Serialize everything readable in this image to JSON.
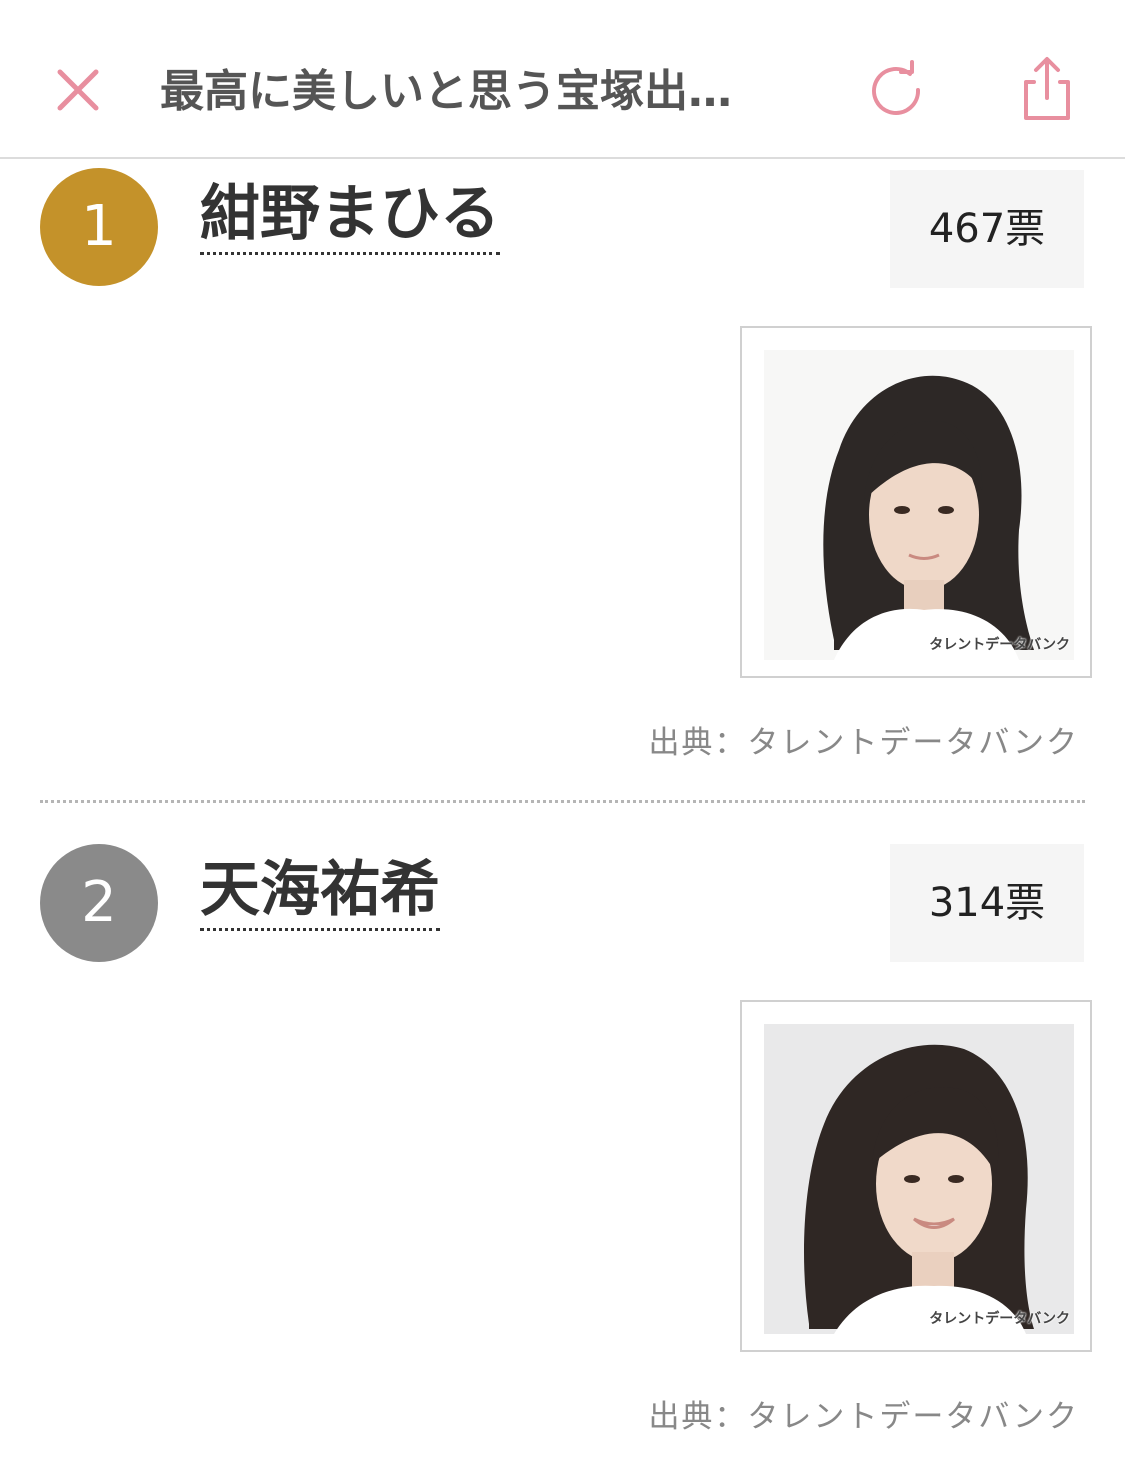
{
  "header": {
    "title": "最高に美しいと思う宝塚出…",
    "close_icon": "close-icon",
    "reload_icon": "reload-icon",
    "share_icon": "share-icon",
    "accent_color": "#e88f9f"
  },
  "entries": [
    {
      "rank": "1",
      "name": "紺野まひる",
      "votes": "467票",
      "badge_color": "#c4922a",
      "photo_watermark": "タレントデータバンク",
      "credit": "出典：タレントデータバンク"
    },
    {
      "rank": "2",
      "name": "天海祐希",
      "votes": "314票",
      "badge_color": "#8a8a8a",
      "photo_watermark": "タレントデータバンク",
      "credit": "出典：タレントデータバンク"
    }
  ]
}
